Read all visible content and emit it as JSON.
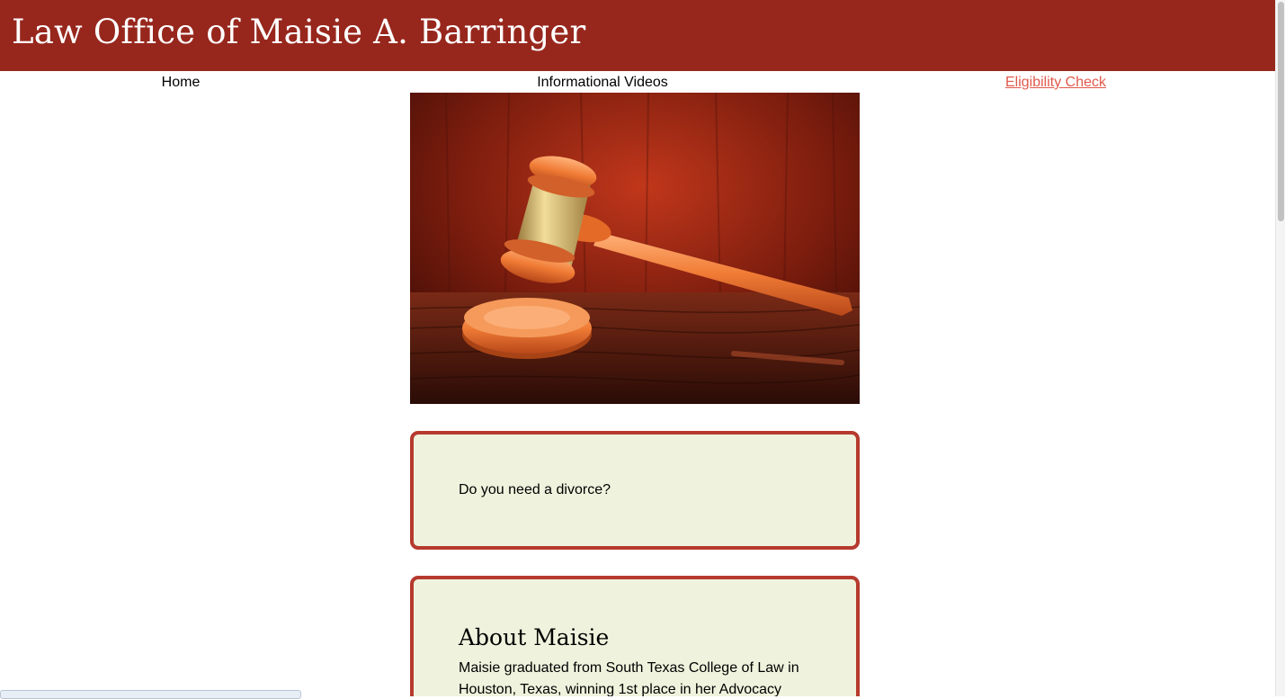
{
  "header": {
    "title": "Law Office of Maisie A. Barringer"
  },
  "nav": {
    "items": [
      {
        "label": "Home"
      },
      {
        "label": "Informational Videos"
      },
      {
        "label": "Eligibility Check"
      }
    ]
  },
  "hero": {
    "icon": "gavel-image"
  },
  "cards": {
    "divorce": {
      "text": "Do you need a divorce?"
    },
    "about": {
      "heading": "About Maisie",
      "body": "Maisie graduated from South Texas College of Law in Houston, Texas, winning 1st place in her Advocacy"
    }
  },
  "colors": {
    "header_bg": "#97271d",
    "card_bg": "#eff3dd",
    "card_border": "#b63a2e",
    "active_link": "#e0594c"
  }
}
